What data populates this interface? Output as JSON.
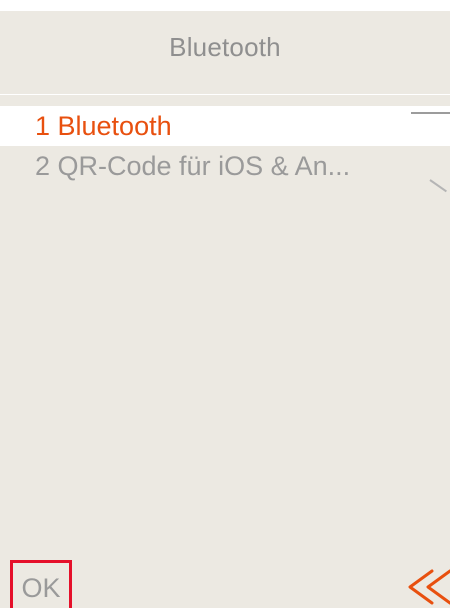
{
  "header": {
    "title": "Bluetooth"
  },
  "menu": {
    "items": [
      {
        "label": "1 Bluetooth",
        "selected": true
      },
      {
        "label": "2 QR-Code für iOS & An...",
        "selected": false
      }
    ]
  },
  "footer": {
    "ok_label": "OK",
    "back_icon": "double-chevron-left-icon"
  },
  "colors": {
    "background": "#ece9e2",
    "accent": "#e8500f",
    "text_muted": "#9a9a9a",
    "highlight_border": "#e5102a"
  }
}
